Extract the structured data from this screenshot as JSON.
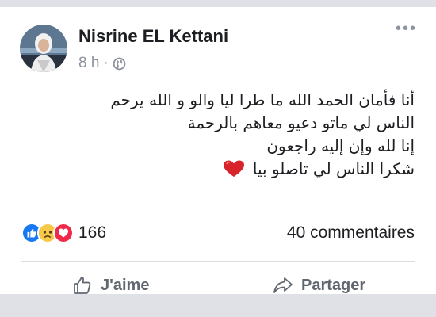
{
  "post": {
    "author": "Nisrine EL Kettani",
    "time": "8 h",
    "separator": "·",
    "privacy_icon": "globe-icon",
    "text_lines": [
      "أنا فأمان الحمد الله ما طرا ليا والو و الله يرحم",
      "الناس لي ماتو دعيو معاهم بالرحمة",
      "إنا لله وإن إليه راجعون",
      "شكرا الناس لي تاصلو بيا"
    ],
    "emoji_icon": "red-heart-icon"
  },
  "reactions": {
    "icons": [
      "like-icon",
      "sad-icon",
      "love-icon"
    ],
    "count": "166",
    "comments": "40 commentaires"
  },
  "actions": {
    "like_label": "J'aime",
    "share_label": "Partager"
  },
  "colors": {
    "page_bg": "#dfe1e6",
    "card_bg": "#ffffff",
    "text": "#1c1e21",
    "muted": "#8d949e",
    "like_blue": "#1877f2",
    "sad_yellow": "#f7c948",
    "love_red": "#f0284a"
  }
}
